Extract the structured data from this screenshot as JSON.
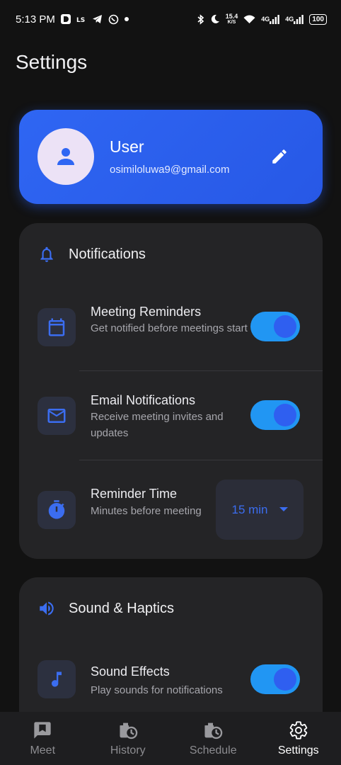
{
  "status_bar": {
    "time": "5:13 PM",
    "speed": "15.4",
    "speed_unit": "K/S",
    "network1": "4G",
    "network2": "4G",
    "battery": "100"
  },
  "page": {
    "title": "Settings"
  },
  "profile": {
    "name": "User",
    "email": "osimiloluwa9@gmail.com"
  },
  "notifications": {
    "title": "Notifications",
    "rows": [
      {
        "title": "Meeting Reminders",
        "subtitle": "Get notified before meetings start",
        "enabled": true
      },
      {
        "title": "Email Notifications",
        "subtitle": "Receive meeting invites and updates",
        "enabled": true
      },
      {
        "title": "Reminder Time",
        "subtitle": "Minutes before meeting",
        "value": "15 min"
      }
    ]
  },
  "sound": {
    "title": "Sound & Haptics",
    "rows": [
      {
        "title": "Sound Effects",
        "subtitle": "Play sounds for notifications",
        "enabled": true
      }
    ]
  },
  "nav": {
    "items": [
      {
        "label": "Meet",
        "icon": "meet-icon"
      },
      {
        "label": "History",
        "icon": "history-icon"
      },
      {
        "label": "Schedule",
        "icon": "schedule-icon"
      },
      {
        "label": "Settings",
        "icon": "gear-icon",
        "active": true
      }
    ]
  },
  "colors": {
    "accent": "#2f66f3",
    "toggle_track": "#2196f3",
    "background": "#121212",
    "card": "#242426"
  }
}
